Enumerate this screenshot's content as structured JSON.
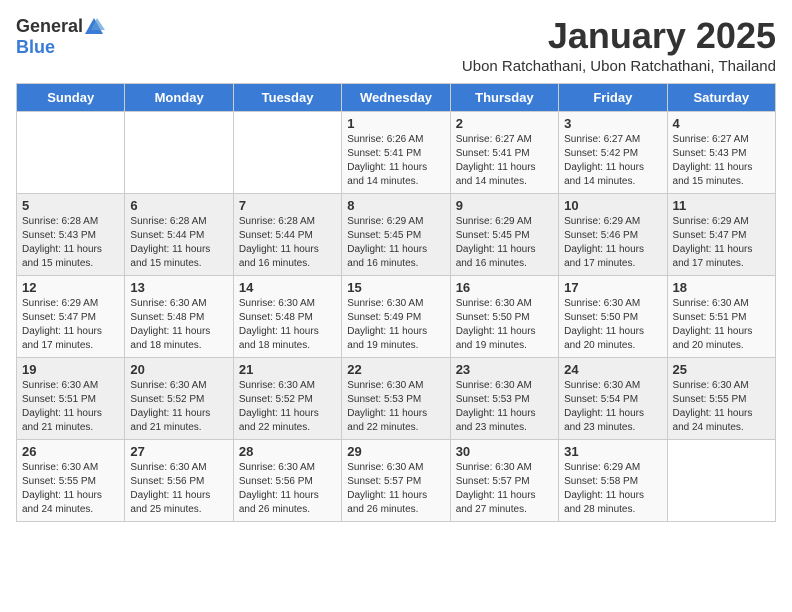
{
  "header": {
    "logo_general": "General",
    "logo_blue": "Blue",
    "month_title": "January 2025",
    "subtitle": "Ubon Ratchathani, Ubon Ratchathani, Thailand"
  },
  "weekdays": [
    "Sunday",
    "Monday",
    "Tuesday",
    "Wednesday",
    "Thursday",
    "Friday",
    "Saturday"
  ],
  "weeks": [
    [
      {
        "day": "",
        "sunrise": "",
        "sunset": "",
        "daylight": ""
      },
      {
        "day": "",
        "sunrise": "",
        "sunset": "",
        "daylight": ""
      },
      {
        "day": "",
        "sunrise": "",
        "sunset": "",
        "daylight": ""
      },
      {
        "day": "1",
        "sunrise": "Sunrise: 6:26 AM",
        "sunset": "Sunset: 5:41 PM",
        "daylight": "Daylight: 11 hours and 14 minutes."
      },
      {
        "day": "2",
        "sunrise": "Sunrise: 6:27 AM",
        "sunset": "Sunset: 5:41 PM",
        "daylight": "Daylight: 11 hours and 14 minutes."
      },
      {
        "day": "3",
        "sunrise": "Sunrise: 6:27 AM",
        "sunset": "Sunset: 5:42 PM",
        "daylight": "Daylight: 11 hours and 14 minutes."
      },
      {
        "day": "4",
        "sunrise": "Sunrise: 6:27 AM",
        "sunset": "Sunset: 5:43 PM",
        "daylight": "Daylight: 11 hours and 15 minutes."
      }
    ],
    [
      {
        "day": "5",
        "sunrise": "Sunrise: 6:28 AM",
        "sunset": "Sunset: 5:43 PM",
        "daylight": "Daylight: 11 hours and 15 minutes."
      },
      {
        "day": "6",
        "sunrise": "Sunrise: 6:28 AM",
        "sunset": "Sunset: 5:44 PM",
        "daylight": "Daylight: 11 hours and 15 minutes."
      },
      {
        "day": "7",
        "sunrise": "Sunrise: 6:28 AM",
        "sunset": "Sunset: 5:44 PM",
        "daylight": "Daylight: 11 hours and 16 minutes."
      },
      {
        "day": "8",
        "sunrise": "Sunrise: 6:29 AM",
        "sunset": "Sunset: 5:45 PM",
        "daylight": "Daylight: 11 hours and 16 minutes."
      },
      {
        "day": "9",
        "sunrise": "Sunrise: 6:29 AM",
        "sunset": "Sunset: 5:45 PM",
        "daylight": "Daylight: 11 hours and 16 minutes."
      },
      {
        "day": "10",
        "sunrise": "Sunrise: 6:29 AM",
        "sunset": "Sunset: 5:46 PM",
        "daylight": "Daylight: 11 hours and 17 minutes."
      },
      {
        "day": "11",
        "sunrise": "Sunrise: 6:29 AM",
        "sunset": "Sunset: 5:47 PM",
        "daylight": "Daylight: 11 hours and 17 minutes."
      }
    ],
    [
      {
        "day": "12",
        "sunrise": "Sunrise: 6:29 AM",
        "sunset": "Sunset: 5:47 PM",
        "daylight": "Daylight: 11 hours and 17 minutes."
      },
      {
        "day": "13",
        "sunrise": "Sunrise: 6:30 AM",
        "sunset": "Sunset: 5:48 PM",
        "daylight": "Daylight: 11 hours and 18 minutes."
      },
      {
        "day": "14",
        "sunrise": "Sunrise: 6:30 AM",
        "sunset": "Sunset: 5:48 PM",
        "daylight": "Daylight: 11 hours and 18 minutes."
      },
      {
        "day": "15",
        "sunrise": "Sunrise: 6:30 AM",
        "sunset": "Sunset: 5:49 PM",
        "daylight": "Daylight: 11 hours and 19 minutes."
      },
      {
        "day": "16",
        "sunrise": "Sunrise: 6:30 AM",
        "sunset": "Sunset: 5:50 PM",
        "daylight": "Daylight: 11 hours and 19 minutes."
      },
      {
        "day": "17",
        "sunrise": "Sunrise: 6:30 AM",
        "sunset": "Sunset: 5:50 PM",
        "daylight": "Daylight: 11 hours and 20 minutes."
      },
      {
        "day": "18",
        "sunrise": "Sunrise: 6:30 AM",
        "sunset": "Sunset: 5:51 PM",
        "daylight": "Daylight: 11 hours and 20 minutes."
      }
    ],
    [
      {
        "day": "19",
        "sunrise": "Sunrise: 6:30 AM",
        "sunset": "Sunset: 5:51 PM",
        "daylight": "Daylight: 11 hours and 21 minutes."
      },
      {
        "day": "20",
        "sunrise": "Sunrise: 6:30 AM",
        "sunset": "Sunset: 5:52 PM",
        "daylight": "Daylight: 11 hours and 21 minutes."
      },
      {
        "day": "21",
        "sunrise": "Sunrise: 6:30 AM",
        "sunset": "Sunset: 5:52 PM",
        "daylight": "Daylight: 11 hours and 22 minutes."
      },
      {
        "day": "22",
        "sunrise": "Sunrise: 6:30 AM",
        "sunset": "Sunset: 5:53 PM",
        "daylight": "Daylight: 11 hours and 22 minutes."
      },
      {
        "day": "23",
        "sunrise": "Sunrise: 6:30 AM",
        "sunset": "Sunset: 5:53 PM",
        "daylight": "Daylight: 11 hours and 23 minutes."
      },
      {
        "day": "24",
        "sunrise": "Sunrise: 6:30 AM",
        "sunset": "Sunset: 5:54 PM",
        "daylight": "Daylight: 11 hours and 23 minutes."
      },
      {
        "day": "25",
        "sunrise": "Sunrise: 6:30 AM",
        "sunset": "Sunset: 5:55 PM",
        "daylight": "Daylight: 11 hours and 24 minutes."
      }
    ],
    [
      {
        "day": "26",
        "sunrise": "Sunrise: 6:30 AM",
        "sunset": "Sunset: 5:55 PM",
        "daylight": "Daylight: 11 hours and 24 minutes."
      },
      {
        "day": "27",
        "sunrise": "Sunrise: 6:30 AM",
        "sunset": "Sunset: 5:56 PM",
        "daylight": "Daylight: 11 hours and 25 minutes."
      },
      {
        "day": "28",
        "sunrise": "Sunrise: 6:30 AM",
        "sunset": "Sunset: 5:56 PM",
        "daylight": "Daylight: 11 hours and 26 minutes."
      },
      {
        "day": "29",
        "sunrise": "Sunrise: 6:30 AM",
        "sunset": "Sunset: 5:57 PM",
        "daylight": "Daylight: 11 hours and 26 minutes."
      },
      {
        "day": "30",
        "sunrise": "Sunrise: 6:30 AM",
        "sunset": "Sunset: 5:57 PM",
        "daylight": "Daylight: 11 hours and 27 minutes."
      },
      {
        "day": "31",
        "sunrise": "Sunrise: 6:29 AM",
        "sunset": "Sunset: 5:58 PM",
        "daylight": "Daylight: 11 hours and 28 minutes."
      },
      {
        "day": "",
        "sunrise": "",
        "sunset": "",
        "daylight": ""
      }
    ]
  ]
}
